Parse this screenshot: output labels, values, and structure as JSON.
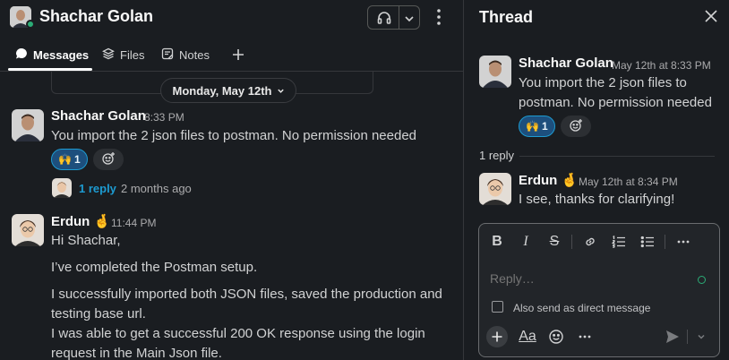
{
  "channel": {
    "title": "Shachar Golan",
    "tabs": [
      {
        "label": "Messages",
        "icon": "message-bubble-icon",
        "active": true
      },
      {
        "label": "Files",
        "icon": "files-stack-icon",
        "active": false
      },
      {
        "label": "Notes",
        "icon": "notes-icon",
        "active": false
      }
    ],
    "date_divider": "Monday, May 12th"
  },
  "messages": [
    {
      "author": "Shachar Golan",
      "time": "8:33 PM",
      "lines": [
        "You import the 2 json files to postman. No permission needed"
      ],
      "reaction": {
        "emoji": "🙌",
        "count": "1"
      },
      "thread": {
        "replies": "1 reply",
        "ago": "2 months ago"
      }
    },
    {
      "author": "Erdun",
      "author_emoji": "🤞",
      "time": "11:44 PM",
      "lines": [
        "Hi Shachar,",
        "I’ve completed the Postman setup.",
        "I successfully imported both JSON files, saved the production and",
        "testing base url.",
        "I was able to get a successful 200 OK response using the login",
        "request in the Main Json file."
      ]
    }
  ],
  "thread": {
    "title": "Thread",
    "parent": {
      "author": "Shachar Golan",
      "time": "May 12th at 8:33 PM",
      "lines": [
        "You import the 2 json files to postman. No permission needed"
      ],
      "reaction": {
        "emoji": "🙌",
        "count": "1"
      }
    },
    "replies_label": "1 reply",
    "reply": {
      "author": "Erdun",
      "author_emoji": "🤞",
      "time": "May 12th at 8:34 PM",
      "text": "I see, thanks for clarifying!"
    },
    "composer": {
      "placeholder": "Reply…",
      "also_send_label": "Also send as direct message",
      "format_label": "Aa"
    }
  },
  "colors": {
    "background": "#1a1d21",
    "link": "#1d9bd1",
    "reaction_bg": "#1d4f7d",
    "presence": "#2bac76"
  }
}
